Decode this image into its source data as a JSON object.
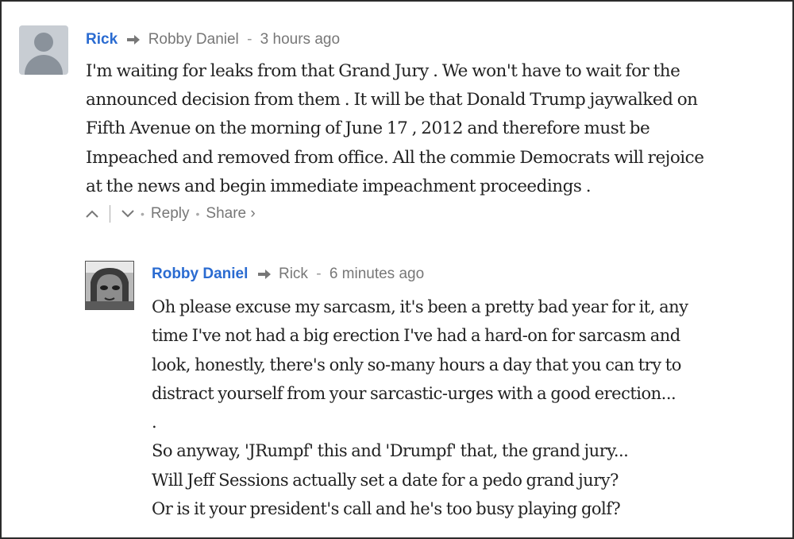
{
  "comments": [
    {
      "author": "Rick",
      "reply_to": "Robby Daniel",
      "separator": "-",
      "time": "3 hours ago",
      "lines": [
        "I'm waiting for leaks from that Grand Jury . We won't have to wait for the",
        "announced decision from them . It will be that Donald Trump jaywalked on",
        "Fifth Avenue on the morning of June 17 , 2012 and therefore must be",
        "Impeached and removed from office. All the commie Democrats will rejoice",
        "at the news and begin immediate impeachment proceedings ."
      ],
      "actions": {
        "reply_label": "Reply",
        "share_label": "Share ›",
        "dot": "•"
      },
      "avatar_icon": "default-user-avatar"
    },
    {
      "author": "Robby Daniel",
      "reply_to": "Rick",
      "separator": "-",
      "time": "6 minutes ago",
      "lines": [
        "Oh please excuse my sarcasm, it's been a pretty bad year for it, any",
        "time I've not had a big erection I've had a hard-on for sarcasm and",
        "look, honestly, there's only so-many hours a day that you can try to",
        "distract yourself from your sarcastic-urges with a good erection...",
        ".",
        "So anyway, 'JRumpf' this and 'Drumpf' that, the grand jury...",
        "Will Jeff Sessions actually set a date for a pedo grand jury?",
        "Or is it your president's call and he's too busy playing golf?"
      ],
      "avatar_icon": "user-photo-avatar"
    }
  ],
  "colors": {
    "author_link": "#2a6bd1",
    "meta_text": "#777777",
    "body_text": "#222222"
  }
}
